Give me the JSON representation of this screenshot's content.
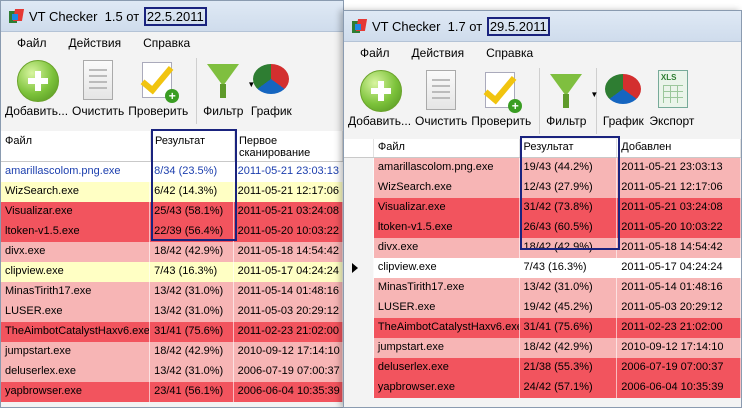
{
  "colors": {
    "white": "#ffffff",
    "yellow": "#ffffc4",
    "pink": "#f7b5b5",
    "red": "#f2545e",
    "blue_text": "#1c3fae"
  },
  "window_left": {
    "title": "VT Checker  1.5 от ",
    "title_date": "22.5.2011",
    "menu": [
      "Файл",
      "Действия",
      "Справка"
    ],
    "toolbar": [
      {
        "icon": "add-icon",
        "label": "Добавить..."
      },
      {
        "icon": "document-icon",
        "label": "Очистить"
      },
      {
        "icon": "checklist-icon",
        "label": "Проверить"
      },
      {
        "icon": "filter-icon",
        "label": "Фильтр"
      },
      {
        "icon": "chart-icon",
        "label": "График"
      }
    ],
    "columns": [
      "Файл",
      "Результат",
      "Первое сканирование"
    ],
    "rows": [
      {
        "file": "amarillascolom.png.exe",
        "result": "8/34 (23.5%)",
        "date": "2011-05-21 23:03:13",
        "bg": "white",
        "text": "blue"
      },
      {
        "file": "WizSearch.exe",
        "result": "6/42 (14.3%)",
        "date": "2011-05-21 12:17:06",
        "bg": "yellow"
      },
      {
        "file": "Visualizar.exe",
        "result": "25/43 (58.1%)",
        "date": "2011-05-21 03:24:08",
        "bg": "red"
      },
      {
        "file": "ltoken-v1.5.exe",
        "result": "22/39 (56.4%)",
        "date": "2011-05-20 10:03:22",
        "bg": "red"
      },
      {
        "file": "divx.exe",
        "result": "18/42 (42.9%)",
        "date": "2011-05-18 14:54:42",
        "bg": "pink"
      },
      {
        "file": "clipview.exe",
        "result": "7/43 (16.3%)",
        "date": "2011-05-17 04:24:24",
        "bg": "yellow"
      },
      {
        "file": "MinasTirith17.exe",
        "result": "13/42 (31.0%)",
        "date": "2011-05-14 01:48:16",
        "bg": "pink"
      },
      {
        "file": "LUSER.exe",
        "result": "13/42 (31.0%)",
        "date": "2011-05-03 20:29:12",
        "bg": "pink"
      },
      {
        "file": "TheAimbotCatalystHaxv6.exe",
        "result": "31/41 (75.6%)",
        "date": "2011-02-23 21:02:00",
        "bg": "red"
      },
      {
        "file": "jumpstart.exe",
        "result": "18/42 (42.9%)",
        "date": "2010-09-12 17:14:10",
        "bg": "pink"
      },
      {
        "file": "deluserlex.exe",
        "result": "13/42 (31.0%)",
        "date": "2006-07-19 07:00:37",
        "bg": "pink"
      },
      {
        "file": "yapbrowser.exe",
        "result": "23/41 (56.1%)",
        "date": "2006-06-04 10:35:39",
        "bg": "red"
      }
    ]
  },
  "window_right": {
    "title": "VT Checker  1.7 от ",
    "title_date": "29.5.2011",
    "menu": [
      "Файл",
      "Действия",
      "Справка"
    ],
    "toolbar": [
      {
        "icon": "add-icon",
        "label": "Добавить..."
      },
      {
        "icon": "document-icon",
        "label": "Очистить"
      },
      {
        "icon": "checklist-icon",
        "label": "Проверить"
      },
      {
        "icon": "filter-icon",
        "label": "Фильтр"
      },
      {
        "icon": "chart-icon",
        "label": "График"
      },
      {
        "icon": "excel-icon",
        "label": "Экспорт"
      }
    ],
    "columns": [
      "Файл",
      "Результат",
      "Добавлен"
    ],
    "rows": [
      {
        "file": "amarillascolom.png.exe",
        "result": "19/43 (44.2%)",
        "date": "2011-05-21 23:03:13",
        "bg": "pink"
      },
      {
        "file": "WizSearch.exe",
        "result": "12/43 (27.9%)",
        "date": "2011-05-21 12:17:06",
        "bg": "pink"
      },
      {
        "file": "Visualizar.exe",
        "result": "31/42 (73.8%)",
        "date": "2011-05-21 03:24:08",
        "bg": "red"
      },
      {
        "file": "ltoken-v1.5.exe",
        "result": "26/43 (60.5%)",
        "date": "2011-05-20 10:03:22",
        "bg": "red"
      },
      {
        "file": "divx.exe",
        "result": "18/42 (42.9%)",
        "date": "2011-05-18 14:54:42",
        "bg": "pink"
      },
      {
        "file": "clipview.exe",
        "result": "7/43 (16.3%)",
        "date": "2011-05-17 04:24:24",
        "bg": "white",
        "selected": true
      },
      {
        "file": "MinasTirith17.exe",
        "result": "13/42 (31.0%)",
        "date": "2011-05-14 01:48:16",
        "bg": "pink"
      },
      {
        "file": "LUSER.exe",
        "result": "19/42 (45.2%)",
        "date": "2011-05-03 20:29:12",
        "bg": "pink"
      },
      {
        "file": "TheAimbotCatalystHaxv6.exe",
        "result": "31/41 (75.6%)",
        "date": "2011-02-23 21:02:00",
        "bg": "red"
      },
      {
        "file": "jumpstart.exe",
        "result": "18/42 (42.9%)",
        "date": "2010-09-12 17:14:10",
        "bg": "pink"
      },
      {
        "file": "deluserlex.exe",
        "result": "21/38 (55.3%)",
        "date": "2006-07-19 07:00:37",
        "bg": "red"
      },
      {
        "file": "yapbrowser.exe",
        "result": "24/42 (57.1%)",
        "date": "2006-06-04 10:35:39",
        "bg": "red"
      }
    ]
  }
}
